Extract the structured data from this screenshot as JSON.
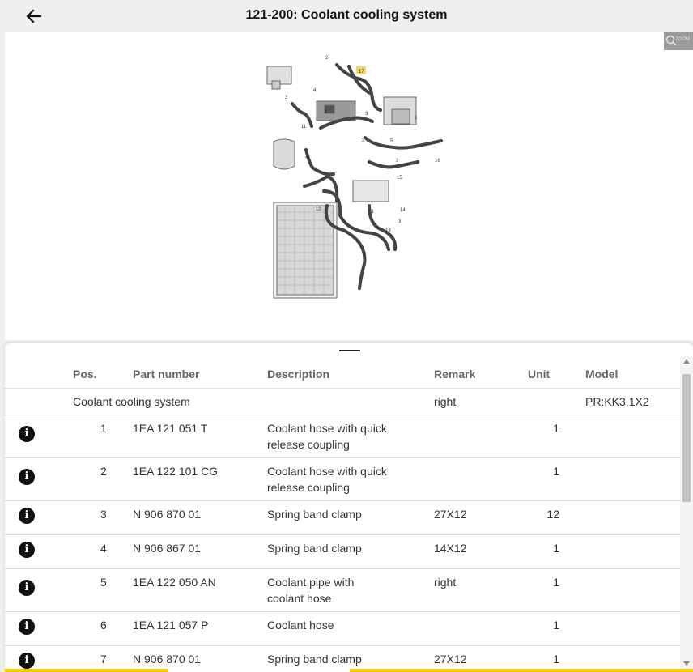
{
  "header": {
    "title": "121-200: Coolant cooling system",
    "back_icon": "arrow-left-icon"
  },
  "diagram": {
    "zoom_label": "ZOOM",
    "highlight_color": "#f3d86b"
  },
  "table": {
    "headers": {
      "pos": "Pos.",
      "part_number": "Part number",
      "description": "Description",
      "remark": "Remark",
      "unit": "Unit",
      "model": "Model"
    },
    "group": {
      "title": "Coolant cooling system",
      "remark": "right",
      "model": "PR:KK3,1X2"
    },
    "rows": [
      {
        "pos": "1",
        "part_number": "1EA 121 051 T",
        "description": "Coolant hose with quick release coupling",
        "remark": "",
        "unit": "1"
      },
      {
        "pos": "2",
        "part_number": "1EA 122 101 CG",
        "description": "Coolant hose with quick release coupling",
        "remark": "",
        "unit": "1"
      },
      {
        "pos": "3",
        "part_number": "N 906 870 01",
        "description": "Spring band clamp",
        "remark": "27X12",
        "unit": "12"
      },
      {
        "pos": "4",
        "part_number": "N 906 867 01",
        "description": "Spring band clamp",
        "remark": "14X12",
        "unit": "1"
      },
      {
        "pos": "5",
        "part_number": "1EA 122 050 AN",
        "description": "Coolant pipe with coolant hose",
        "remark": "right",
        "unit": "1"
      },
      {
        "pos": "6",
        "part_number": "1EA 121 057 P",
        "description": "Coolant hose",
        "remark": "",
        "unit": "1"
      },
      {
        "pos": "7",
        "part_number": "N 906 870 01",
        "description": "Spring band clamp",
        "remark": "27X12",
        "unit": "1"
      }
    ]
  },
  "colors": {
    "accent_yellow": "#f5c800",
    "info_icon": "#111111"
  }
}
